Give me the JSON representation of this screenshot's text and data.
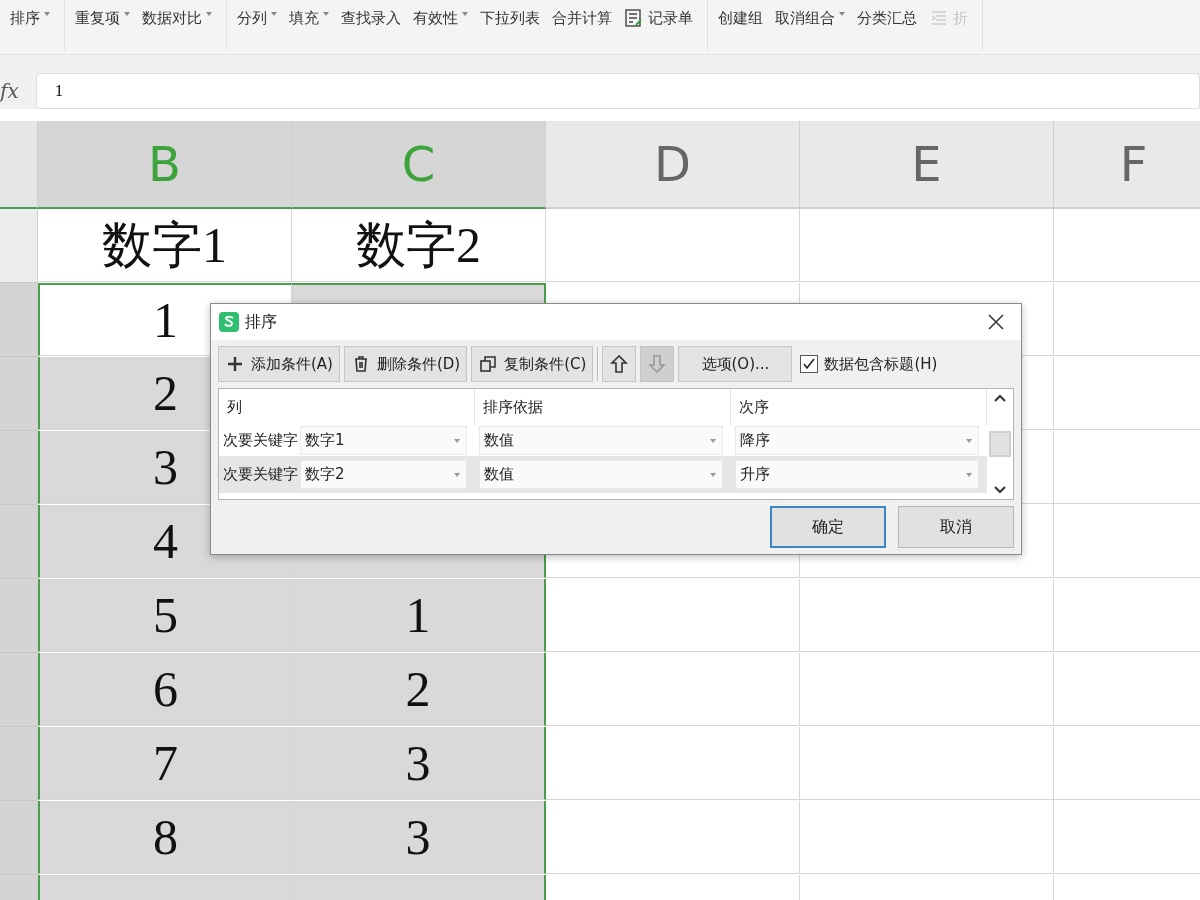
{
  "toolbar": {
    "groups": [
      [
        {
          "label": "排序",
          "kind": "text",
          "dropdown": true,
          "disabled": false
        }
      ],
      [
        {
          "label": "重复项",
          "kind": "text",
          "dropdown": true,
          "disabled": false
        },
        {
          "label": "数据对比",
          "kind": "text",
          "dropdown": true,
          "disabled": false
        }
      ],
      [
        {
          "label": "分列",
          "kind": "text",
          "dropdown": true,
          "disabled": false
        },
        {
          "label": "填充",
          "kind": "text",
          "dropdown": true,
          "disabled": false
        },
        {
          "label": "查找录入",
          "kind": "text",
          "dropdown": false,
          "disabled": false
        },
        {
          "label": "有效性",
          "kind": "text",
          "dropdown": true,
          "disabled": false
        },
        {
          "label": "下拉列表",
          "kind": "text",
          "dropdown": false,
          "disabled": false
        },
        {
          "label": "合并计算",
          "kind": "text",
          "dropdown": false,
          "disabled": false
        },
        {
          "label": "记录单",
          "kind": "form",
          "dropdown": false,
          "disabled": false
        }
      ],
      [
        {
          "label": "创建组",
          "kind": "text",
          "dropdown": false,
          "disabled": false
        },
        {
          "label": "取消组合",
          "kind": "text",
          "dropdown": true,
          "disabled": false
        },
        {
          "label": "分类汇总",
          "kind": "text",
          "dropdown": false,
          "disabled": false
        },
        {
          "label": "折",
          "kind": "fold",
          "dropdown": false,
          "disabled": true
        }
      ]
    ]
  },
  "formula_bar": {
    "label": "fx",
    "value": "1"
  },
  "sheet": {
    "columns": [
      {
        "label": "B",
        "selected": true
      },
      {
        "label": "C",
        "selected": true
      },
      {
        "label": "D",
        "selected": false
      },
      {
        "label": "E",
        "selected": false
      },
      {
        "label": "F",
        "selected": false
      }
    ],
    "rows": [
      {
        "in_selection": false,
        "cells": [
          {
            "text": "数字1",
            "selected": false
          },
          {
            "text": "数字2",
            "selected": false
          }
        ]
      },
      {
        "in_selection": true,
        "cells": [
          {
            "text": "1",
            "selected": false
          },
          {
            "selected": true
          }
        ]
      },
      {
        "in_selection": true,
        "cells": [
          {
            "text": "2",
            "selected": true
          },
          {}
        ]
      },
      {
        "in_selection": true,
        "cells": [
          {
            "text": "3",
            "selected": true
          },
          {}
        ]
      },
      {
        "in_selection": true,
        "cells": [
          {
            "text": "4",
            "selected": true
          },
          {
            "selected": true
          }
        ]
      },
      {
        "in_selection": true,
        "cells": [
          {
            "text": "5",
            "selected": true
          },
          {
            "text": "1",
            "selected": true
          }
        ]
      },
      {
        "in_selection": true,
        "cells": [
          {
            "text": "6",
            "selected": true
          },
          {
            "text": "2",
            "selected": true
          }
        ]
      },
      {
        "in_selection": true,
        "cells": [
          {
            "text": "7",
            "selected": true
          },
          {
            "text": "3",
            "selected": true
          }
        ]
      },
      {
        "in_selection": true,
        "cells": [
          {
            "text": "8",
            "selected": true
          },
          {
            "text": "3",
            "selected": true
          }
        ]
      },
      {
        "in_selection": true,
        "cells": [
          {
            "selected": true
          },
          {
            "selected": true
          }
        ]
      }
    ]
  },
  "dialog": {
    "title": "排序",
    "tools": [
      {
        "kind": "add",
        "label": "添加条件(A)",
        "disabled": false
      },
      {
        "kind": "delete",
        "label": "删除条件(D)",
        "disabled": false
      },
      {
        "kind": "copy",
        "label": "复制条件(C)",
        "disabled": false
      },
      {
        "kind": "up",
        "disabled": false
      },
      {
        "kind": "down",
        "disabled": true
      },
      {
        "kind": "options",
        "label": "选项(O)...",
        "disabled": false
      }
    ],
    "header_checkbox": {
      "label": "数据包含标题(H)",
      "checked": true
    },
    "columns": [
      "列",
      "排序依据",
      "次序"
    ],
    "rows": [
      {
        "key": "次要关键字",
        "column": "数字1",
        "basis": "数值",
        "order": "降序",
        "selected": false
      },
      {
        "key": "次要关键字",
        "column": "数字2",
        "basis": "数值",
        "order": "升序",
        "selected": true
      }
    ],
    "buttons": [
      {
        "label": "确定",
        "default": true
      },
      {
        "label": "取消",
        "default": false
      }
    ]
  }
}
